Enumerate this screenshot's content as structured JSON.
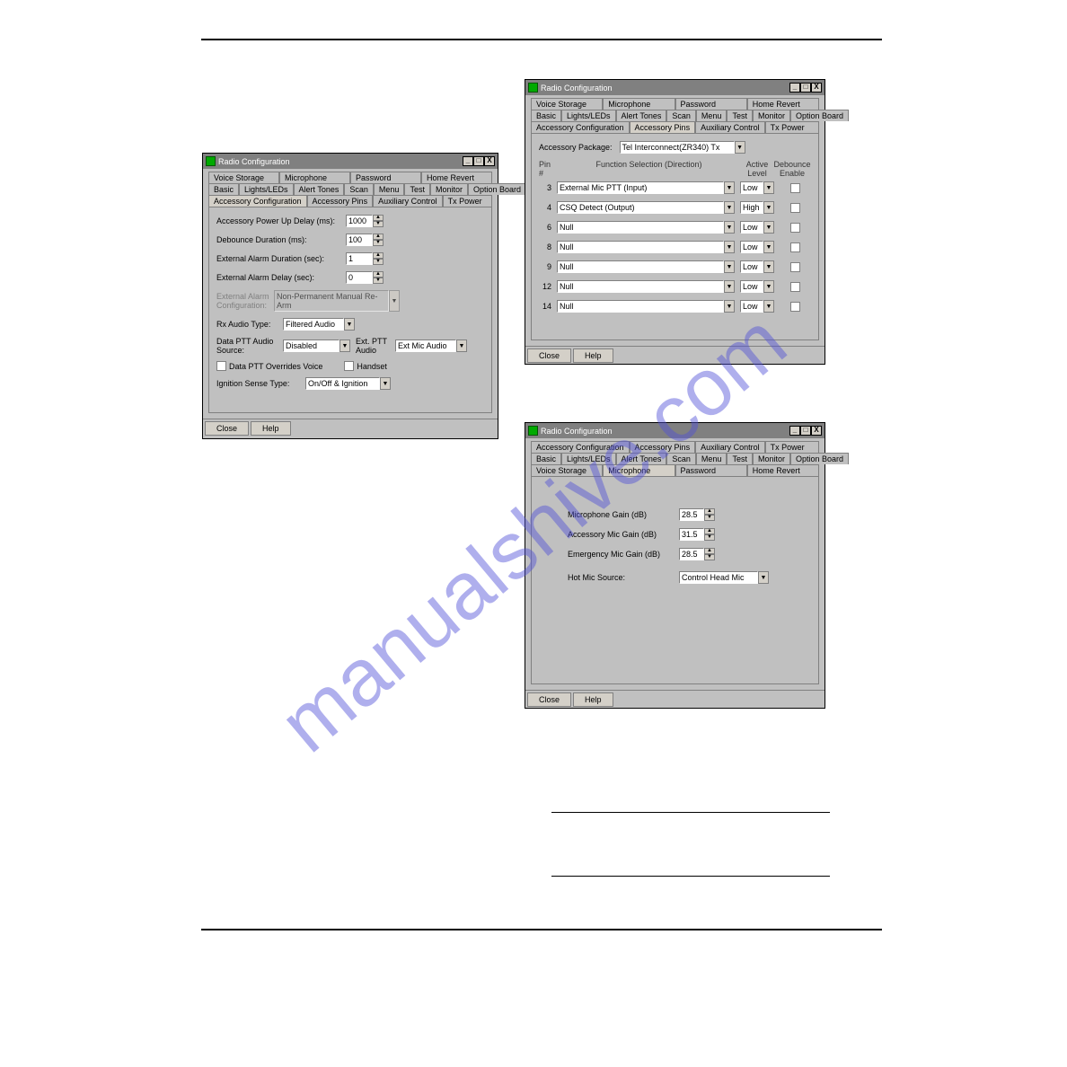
{
  "watermark": "manualshive.com",
  "windows_title": "Radio Configuration",
  "window_controls": {
    "min": "_",
    "max": "□",
    "close": "X"
  },
  "tabs_row1": [
    "Voice Storage",
    "Microphone",
    "Password",
    "Home Revert"
  ],
  "tabs_row2": [
    "Basic",
    "Lights/LEDs",
    "Alert Tones",
    "Scan",
    "Menu",
    "Test",
    "Monitor",
    "Option Board"
  ],
  "tabs_row3": [
    "Accessory Configuration",
    "Accessory Pins",
    "Auxiliary Control",
    "Tx Power"
  ],
  "win1": {
    "active_tab": "Accessory Configuration",
    "fields": {
      "powerup_label": "Accessory Power Up Delay (ms):",
      "powerup_value": "1000",
      "debounce_label": "Debounce Duration (ms):",
      "debounce_value": "100",
      "ext_alarm_dur_label": "External Alarm Duration (sec):",
      "ext_alarm_dur_value": "1",
      "ext_alarm_delay_label": "External Alarm Delay (sec):",
      "ext_alarm_delay_value": "0",
      "ext_alarm_cfg_label": "External Alarm Configuration:",
      "ext_alarm_cfg_value": "Non-Permanent Manual Re-Arm",
      "rx_audio_label": "Rx Audio Type:",
      "rx_audio_value": "Filtered Audio",
      "data_ptt_src_label": "Data PTT Audio Source:",
      "data_ptt_src_value": "Disabled",
      "ext_ptt_audio_label": "Ext. PTT Audio",
      "ext_ptt_audio_value": "Ext Mic Audio",
      "chk_data_ptt_override": "Data PTT Overrides Voice",
      "chk_handset": "Handset",
      "ignition_label": "Ignition Sense Type:",
      "ignition_value": "On/Off & Ignition"
    }
  },
  "win2": {
    "active_tab": "Accessory Pins",
    "package_label": "Accessory Package:",
    "package_value": "Tel Interconnect(ZR340) Tx",
    "headers": {
      "pin": "Pin #",
      "func": "Function Selection (Direction)",
      "active_level": "Active Level",
      "debounce_enable": "Debounce Enable"
    },
    "pins": [
      {
        "num": "3",
        "func": "External Mic PTT (Input)",
        "level": "Low"
      },
      {
        "num": "4",
        "func": "CSQ Detect (Output)",
        "level": "High"
      },
      {
        "num": "6",
        "func": "Null",
        "level": "Low"
      },
      {
        "num": "8",
        "func": "Null",
        "level": "Low"
      },
      {
        "num": "9",
        "func": "Null",
        "level": "Low"
      },
      {
        "num": "12",
        "func": "Null",
        "level": "Low"
      },
      {
        "num": "14",
        "func": "Null",
        "level": "Low"
      }
    ]
  },
  "win3": {
    "active_tab": "Microphone",
    "fields": {
      "mic_gain_label": "Microphone Gain (dB)",
      "mic_gain_value": "28.5",
      "acc_mic_gain_label": "Accessory Mic Gain (dB)",
      "acc_mic_gain_value": "31.5",
      "emerg_mic_gain_label": "Emergency Mic Gain (dB)",
      "emerg_mic_gain_value": "28.5",
      "hot_mic_label": "Hot Mic Source:",
      "hot_mic_value": "Control Head Mic"
    }
  },
  "buttons": {
    "close": "Close",
    "help": "Help"
  },
  "dropdown_arrow": "▼",
  "spin_up": "▲",
  "spin_down": "▼"
}
